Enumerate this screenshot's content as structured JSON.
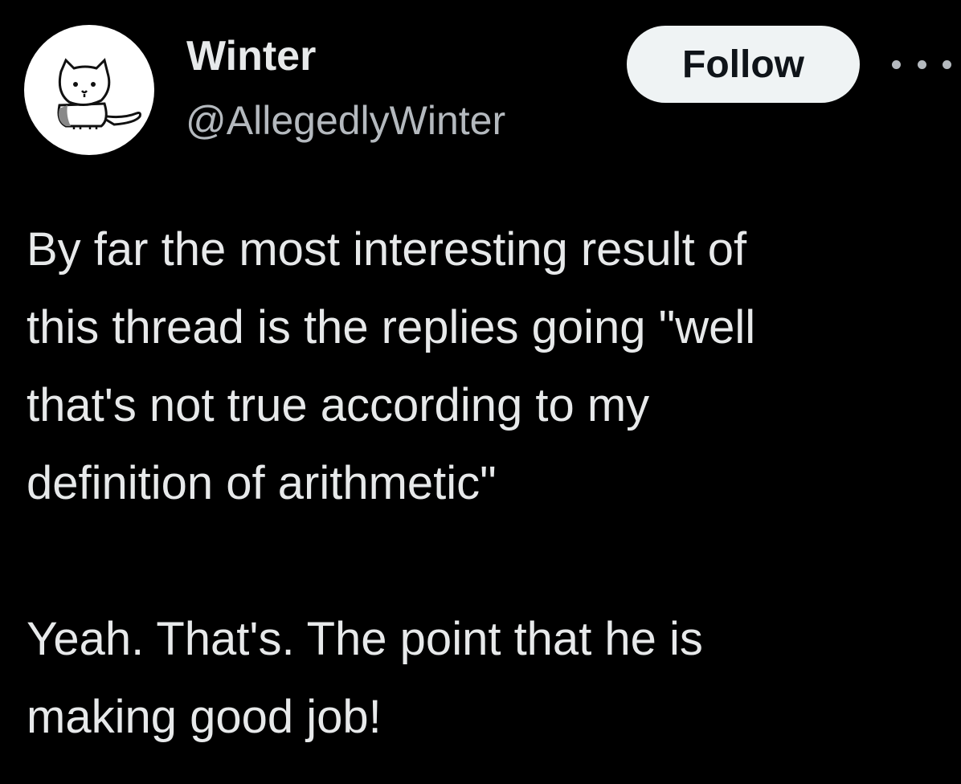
{
  "author": {
    "display_name": "Winter",
    "handle": "@AllegedlyWinter",
    "avatar_icon": "cat-avatar-icon"
  },
  "actions": {
    "follow_label": "Follow",
    "more_icon": "more-options-icon"
  },
  "tweet": {
    "text": "By far the most interesting result of\nthis thread is the replies going \"well\nthat's not true according to my\ndefinition of arithmetic\"\n\nYeah. That's. The point that he is\nmaking good job!"
  },
  "colors": {
    "background": "#000000",
    "primary_text": "#e7e9ea",
    "secondary_text": "#b4b9be",
    "follow_button_bg": "#eff3f4",
    "follow_button_text": "#0f1419"
  }
}
